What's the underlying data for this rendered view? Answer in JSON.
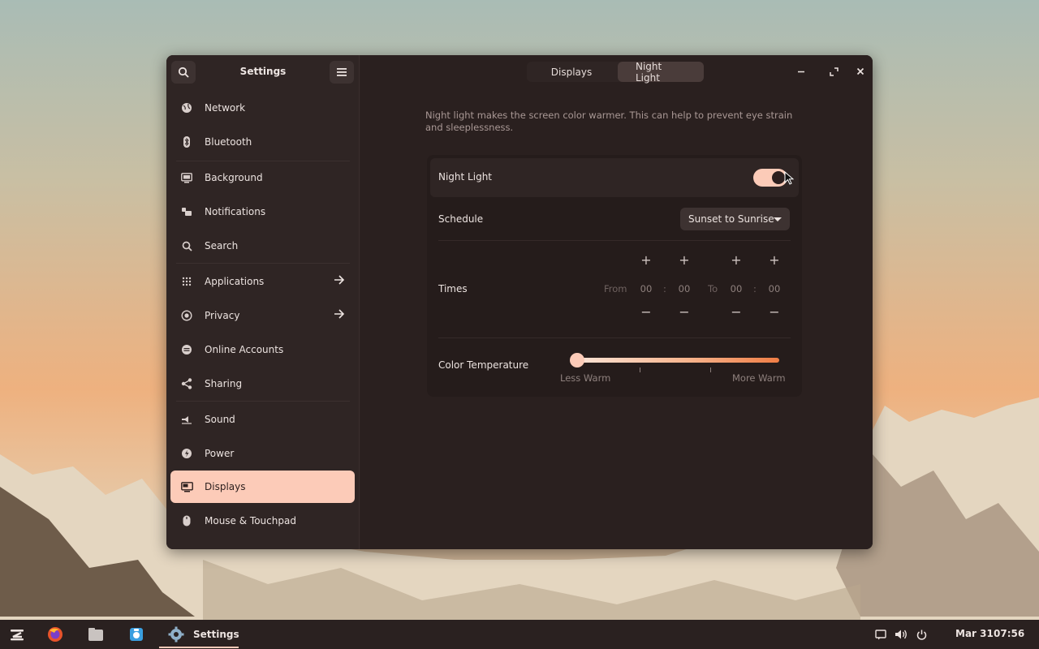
{
  "window": {
    "sidebar_title": "Settings",
    "nav": [
      {
        "label": "Network",
        "icon": "globe-icon"
      },
      {
        "label": "Bluetooth",
        "icon": "bluetooth-icon"
      },
      {
        "label": "Background",
        "icon": "monitor-icon"
      },
      {
        "label": "Notifications",
        "icon": "bell-icon"
      },
      {
        "label": "Search",
        "icon": "search-icon"
      },
      {
        "label": "Applications",
        "icon": "grid-icon",
        "arrow": true
      },
      {
        "label": "Privacy",
        "icon": "privacy-icon",
        "arrow": true
      },
      {
        "label": "Online Accounts",
        "icon": "accounts-icon"
      },
      {
        "label": "Sharing",
        "icon": "share-icon"
      },
      {
        "label": "Sound",
        "icon": "speaker-icon"
      },
      {
        "label": "Power",
        "icon": "power-icon"
      },
      {
        "label": "Displays",
        "icon": "display-icon",
        "active": true
      },
      {
        "label": "Mouse & Touchpad",
        "icon": "mouse-icon"
      }
    ],
    "tabs": [
      {
        "label": "Displays",
        "selected": false
      },
      {
        "label": "Night Light",
        "selected": true
      }
    ]
  },
  "night_light": {
    "description": "Night light makes the screen color warmer. This can help to prevent eye strain and sleeplessness.",
    "toggle_label": "Night Light",
    "toggle_on": true,
    "schedule_label": "Schedule",
    "schedule_value": "Sunset to Sunrise",
    "times_label": "Times",
    "from_label": "From",
    "to_label": "To",
    "from_hours": "00",
    "from_minutes": "00",
    "to_hours": "00",
    "to_minutes": "00",
    "separator": ":",
    "temperature_label": "Color Temperature",
    "less_warm": "Less Warm",
    "more_warm": "More Warm",
    "temperature_level": 0.0
  },
  "taskbar": {
    "active_app": "Settings",
    "date": "Mar 31",
    "time": "07:56"
  },
  "colors": {
    "accent": "#fccbb8",
    "window_bg": "#2c2221"
  }
}
